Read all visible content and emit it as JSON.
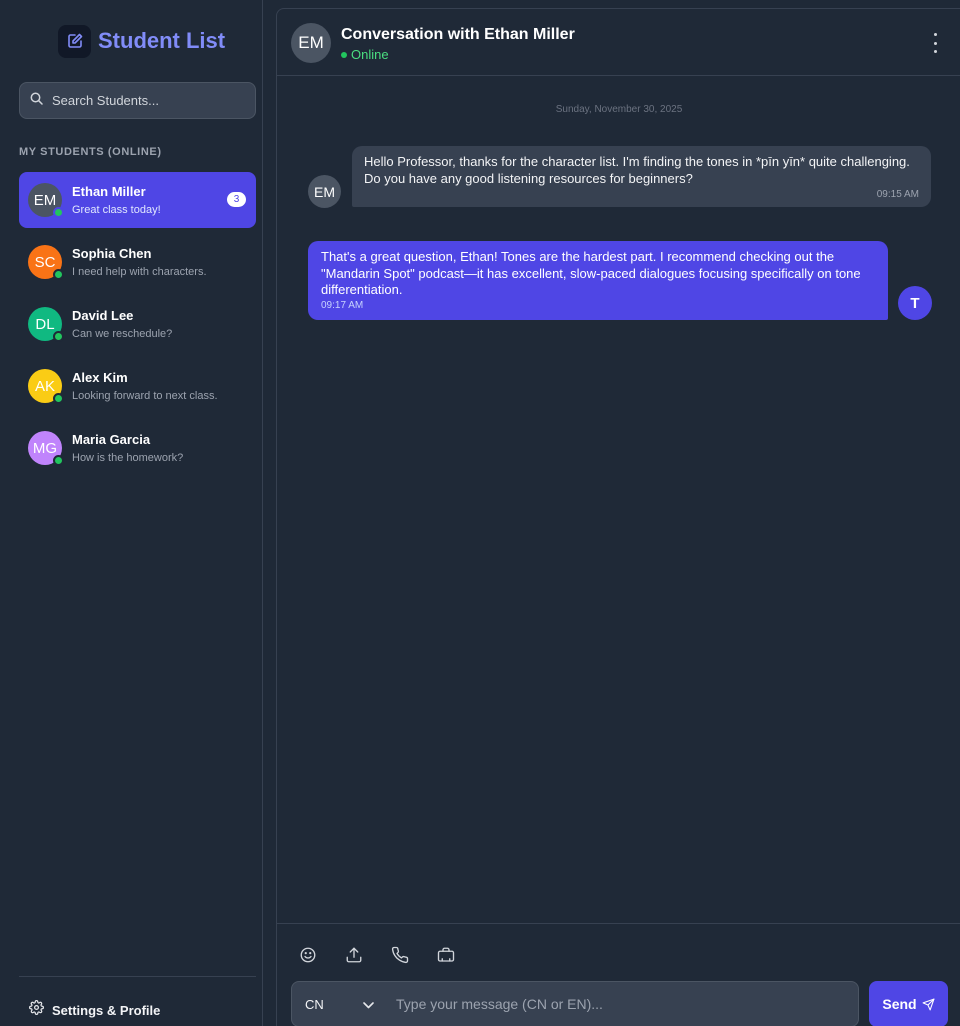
{
  "sidebar": {
    "title": "Student List",
    "search_placeholder": "Search Students...",
    "section_label": "MY STUDENTS (ONLINE)",
    "students": [
      {
        "initials": "EM",
        "name": "Ethan Miller",
        "preview": "Great class today!",
        "unread": "3",
        "color": "#4b5563",
        "active": true,
        "online": true
      },
      {
        "initials": "SC",
        "name": "Sophia Chen",
        "preview": "I need help with characters.",
        "color": "#f97316",
        "active": false,
        "online": true
      },
      {
        "initials": "DL",
        "name": "David Lee",
        "preview": "Can we reschedule?",
        "color": "#10b981",
        "active": false,
        "online": true
      },
      {
        "initials": "AK",
        "name": "Alex Kim",
        "preview": "Looking forward to next class.",
        "color": "#facc15",
        "active": false,
        "online": true
      },
      {
        "initials": "MG",
        "name": "Maria Garcia",
        "preview": "How is the homework?",
        "color": "#c084fc",
        "active": false,
        "online": true
      }
    ],
    "settings_label": "Settings & Profile"
  },
  "chat": {
    "header": {
      "avatar_initials": "EM",
      "title": "Conversation with Ethan Miller",
      "status": "Online"
    },
    "date_label": "Sunday, November 30, 2025",
    "messages": [
      {
        "sender_initials": "EM",
        "text": "Hello Professor, thanks for the character list. I'm finding the tones in *pīn yīn* quite challenging. Do you have any good listening resources for beginners?",
        "time": "09:15 AM"
      },
      {
        "sender_initials": "T",
        "text": "That's a great question, Ethan! Tones are the hardest part. I recommend checking out the \"Mandarin Spot\" podcast—it has excellent, slow-paced dialogues focusing specifically on tone differentiation.",
        "time": "09:17 AM"
      }
    ],
    "composer": {
      "tools": [
        "smile-icon",
        "upload-icon",
        "phone-icon",
        "briefcase-icon"
      ],
      "language": "CN",
      "input_placeholder": "Type your message (CN or EN)...",
      "send_label": "Send"
    }
  },
  "colors": {
    "accent": "#4f46e5",
    "brand_text": "#818cf8",
    "online": "#22c55e",
    "background": "#1f2937"
  }
}
